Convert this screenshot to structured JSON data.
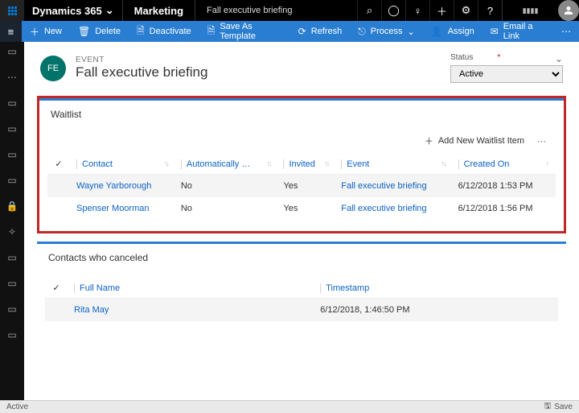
{
  "topbar": {
    "brand": "Dynamics 365",
    "module": "Marketing",
    "breadcrumb": "Fall executive briefing"
  },
  "commands": {
    "new": "New",
    "delete": "Delete",
    "deactivate": "Deactivate",
    "save_template": "Save As Template",
    "refresh": "Refresh",
    "process": "Process",
    "assign": "Assign",
    "email_link": "Email a Link"
  },
  "record": {
    "type": "EVENT",
    "chip": "FE",
    "title": "Fall executive briefing",
    "status_label": "Status",
    "status_value": "Active"
  },
  "waitlist": {
    "title": "Waitlist",
    "add_label": "Add New Waitlist Item",
    "cols": {
      "contact": "Contact",
      "auto": "Automatically …",
      "invited": "Invited",
      "event": "Event",
      "created": "Created On"
    },
    "rows": [
      {
        "contact": "Wayne Yarborough",
        "auto": "No",
        "invited": "Yes",
        "event": "Fall executive briefing",
        "created": "6/12/2018 1:53 PM"
      },
      {
        "contact": "Spenser Moorman",
        "auto": "No",
        "invited": "Yes",
        "event": "Fall executive briefing",
        "created": "6/12/2018 1:56 PM"
      }
    ]
  },
  "canceled": {
    "title": "Contacts who canceled",
    "cols": {
      "full_name": "Full Name",
      "timestamp": "Timestamp"
    },
    "rows": [
      {
        "full_name": "Rita May",
        "timestamp": "6/12/2018, 1:46:50 PM"
      }
    ]
  },
  "statusbar": {
    "left": "Active",
    "save": "Save"
  }
}
